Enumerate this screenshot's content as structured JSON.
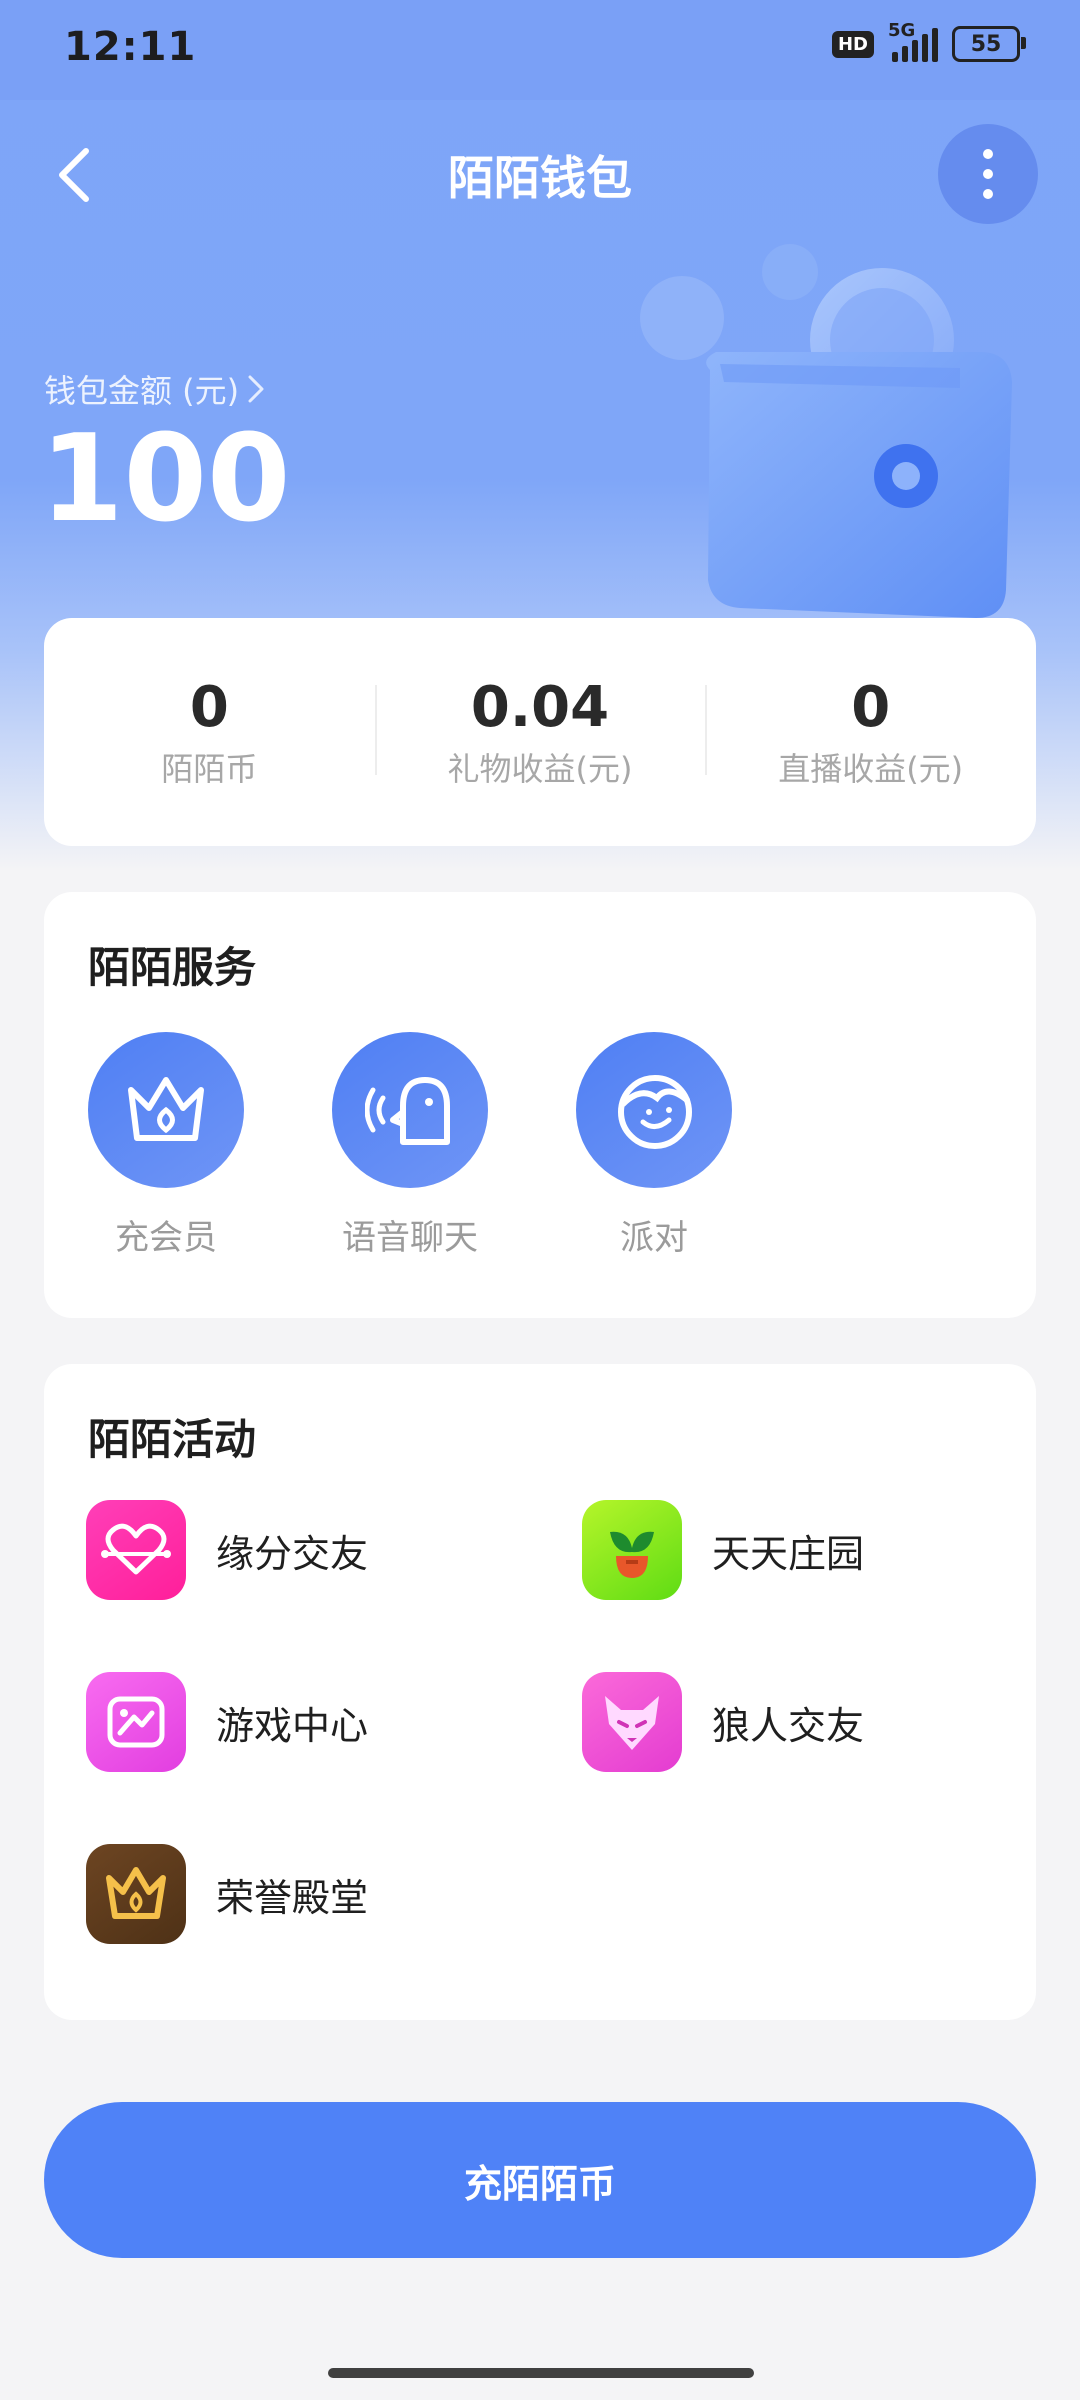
{
  "status_bar": {
    "time": "12:11",
    "hd": "HD",
    "network": "5G",
    "battery": "55"
  },
  "header": {
    "title": "陌陌钱包"
  },
  "balance": {
    "label": "钱包金额 (元)",
    "value": "100"
  },
  "stats": [
    {
      "value": "0",
      "label": "陌陌币"
    },
    {
      "value": "0.04",
      "label": "礼物收益(元)"
    },
    {
      "value": "0",
      "label": "直播收益(元)"
    }
  ],
  "services": {
    "title": "陌陌服务",
    "items": [
      {
        "label": "充会员",
        "icon": "crown-icon"
      },
      {
        "label": "语音聊天",
        "icon": "voice-chat-icon"
      },
      {
        "label": "派对",
        "icon": "party-icon"
      }
    ]
  },
  "activities": {
    "title": "陌陌活动",
    "items": [
      {
        "label": "缘分交友",
        "icon": "heart-icon",
        "color": "#ff2aa8"
      },
      {
        "label": "天天庄园",
        "icon": "sprout-icon",
        "color": "#7de61e"
      },
      {
        "label": "游戏中心",
        "icon": "game-icon",
        "color": "#f048e8"
      },
      {
        "label": "狼人交友",
        "icon": "wolf-icon",
        "color": "#f24fd7"
      },
      {
        "label": "荣誉殿堂",
        "icon": "honor-crown-icon",
        "color": "#5c3b1d"
      }
    ]
  },
  "cta": {
    "label": "充陌陌币"
  },
  "colors": {
    "accent": "#4f82f7",
    "header_bg": "#7ea5f8"
  }
}
